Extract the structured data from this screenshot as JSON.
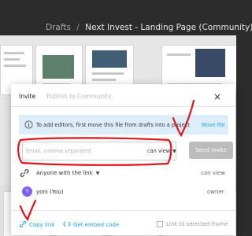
{
  "header": {
    "breadcrumb_root": "Drafts",
    "breadcrumb_separator": "/",
    "file_name": "Next Invest - Landing Page (Community)"
  },
  "share_modal": {
    "tabs": [
      {
        "label": "Invite",
        "active": true
      },
      {
        "label": "Publish to Community",
        "active": false
      }
    ],
    "notice": {
      "text": "To add editors, first move this file from drafts into a project",
      "action": "Move file"
    },
    "email": {
      "placeholder": "Email, comma separated",
      "permission": "can view"
    },
    "send_label": "Send invite",
    "link_sharing": {
      "access": "Anyone with the link",
      "permission": "can view"
    },
    "members": [
      {
        "initial": "Y",
        "name": "yoni (You)",
        "role": "owner"
      }
    ],
    "footer": {
      "copy_link": "Copy link",
      "embed_code": "Get embed code",
      "link_to_frame": "Link to selected frame"
    }
  },
  "colors": {
    "accent": "#18a0fb",
    "notice_bg": "#ddeefa",
    "send_disabled": "#bcbcbc",
    "avatar": "#7b61ff",
    "annotation": "#e0131b"
  }
}
